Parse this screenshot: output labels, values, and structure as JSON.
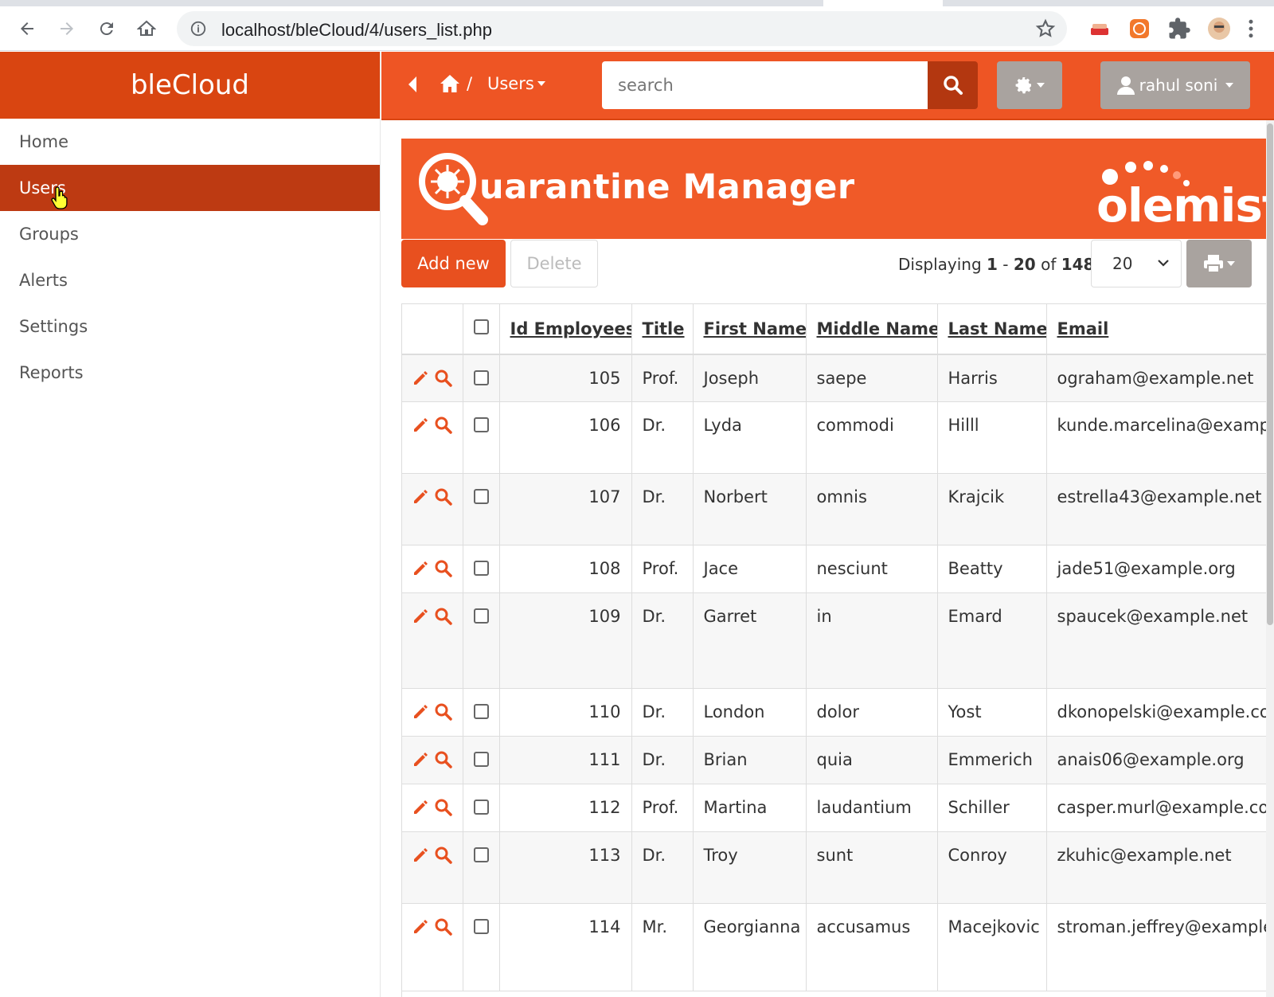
{
  "browser": {
    "url": "localhost/bleCloud/4/users_list.php"
  },
  "sidebar": {
    "brand": "bleCloud",
    "items": [
      {
        "label": "Home"
      },
      {
        "label": "Users"
      },
      {
        "label": "Groups"
      },
      {
        "label": "Alerts"
      },
      {
        "label": "Settings"
      },
      {
        "label": "Reports"
      }
    ],
    "active_index": 1
  },
  "topbar": {
    "breadcrumb_separator": "/",
    "breadcrumb_current": "Users",
    "search_placeholder": "search",
    "user_name": "rahul soni"
  },
  "banner": {
    "title": "uarantine Manager",
    "brand": "olemist"
  },
  "actions": {
    "add_label": "Add new",
    "delete_label": "Delete",
    "displaying_prefix": "Displaying",
    "range_start": "1",
    "range_sep": "-",
    "range_end": "20",
    "of_label": "of",
    "total": "148",
    "page_size": "20"
  },
  "table": {
    "columns": [
      "Id Employees",
      "Title",
      "First Name",
      "Middle Name",
      "Last Name",
      "Email"
    ],
    "rows": [
      {
        "id": "105",
        "title": "Prof.",
        "first": "Joseph",
        "middle": "saepe",
        "last": "Harris",
        "email": "ograham@example.net"
      },
      {
        "id": "106",
        "title": "Dr.",
        "first": "Lyda",
        "middle": "commodi",
        "last": "Hilll",
        "email": "kunde.marcelina@example.com"
      },
      {
        "id": "107",
        "title": "Dr.",
        "first": "Norbert",
        "middle": "omnis",
        "last": "Krajcik",
        "email": "estrella43@example.net"
      },
      {
        "id": "108",
        "title": "Prof.",
        "first": "Jace",
        "middle": "nesciunt",
        "last": "Beatty",
        "email": "jade51@example.org"
      },
      {
        "id": "109",
        "title": "Dr.",
        "first": "Garret",
        "middle": "in",
        "last": "Emard",
        "email": "spaucek@example.net"
      },
      {
        "id": "110",
        "title": "Dr.",
        "first": "London",
        "middle": "dolor",
        "last": "Yost",
        "email": "dkonopelski@example.com"
      },
      {
        "id": "111",
        "title": "Dr.",
        "first": "Brian",
        "middle": "quia",
        "last": "Emmerich",
        "email": "anais06@example.org"
      },
      {
        "id": "112",
        "title": "Prof.",
        "first": "Martina",
        "middle": "laudantium",
        "last": "Schiller",
        "email": "casper.murl@example.com"
      },
      {
        "id": "113",
        "title": "Dr.",
        "first": "Troy",
        "middle": "sunt",
        "last": "Conroy",
        "email": "zkuhic@example.net"
      },
      {
        "id": "114",
        "title": "Mr.",
        "first": "Georgianna",
        "middle": "accusamus",
        "last": "Macejkovic",
        "email": "stroman.jeffrey@example.com"
      }
    ]
  },
  "colors": {
    "brand_dark": "#d94511",
    "brand": "#ee5524",
    "active_nav": "#bd3a12",
    "icon_orange": "#e8501f",
    "grey_button": "#a9a39f"
  }
}
